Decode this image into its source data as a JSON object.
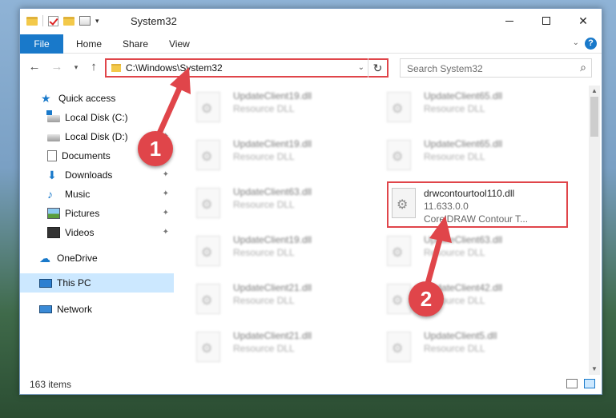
{
  "window": {
    "title": "System32"
  },
  "ribbon": {
    "tabs": [
      {
        "label": "File"
      },
      {
        "label": "Home"
      },
      {
        "label": "Share"
      },
      {
        "label": "View"
      }
    ]
  },
  "navigation": {
    "address_path": "C:\\Windows\\System32",
    "search_placeholder": "Search System32"
  },
  "sidebar": {
    "items": [
      {
        "label": "Quick access",
        "icon": "star-icon"
      },
      {
        "label": "Local Disk (C:)",
        "icon": "drive-icon"
      },
      {
        "label": "Local Disk (D:)",
        "icon": "drive-icon",
        "pinned": true
      },
      {
        "label": "Documents",
        "icon": "documents-icon",
        "pinned": true
      },
      {
        "label": "Downloads",
        "icon": "downloads-icon",
        "pinned": true
      },
      {
        "label": "Music",
        "icon": "music-icon",
        "pinned": true
      },
      {
        "label": "Pictures",
        "icon": "pictures-icon",
        "pinned": true
      },
      {
        "label": "Videos",
        "icon": "videos-icon",
        "pinned": true
      },
      {
        "label": "OneDrive",
        "icon": "cloud-icon"
      },
      {
        "label": "This PC",
        "icon": "computer-icon",
        "selected": true
      },
      {
        "label": "Network",
        "icon": "network-icon"
      }
    ]
  },
  "files": [
    {
      "name": "UpdateClient19.dll",
      "desc": "Resource DLL"
    },
    {
      "name": "UpdateClient65.dll",
      "desc": "Resource DLL"
    },
    {
      "name": "UpdateClient19.dll",
      "desc": "Resource DLL"
    },
    {
      "name": "UpdateClient65.dll",
      "desc": "Resource DLL"
    },
    {
      "name": "UpdateClient63.dll",
      "desc": "Resource DLL"
    },
    {
      "name": "drwcontourtool110.dll",
      "version": "11.633.0.0",
      "desc": "CorelDRAW Contour T..."
    },
    {
      "name": "UpdateClient19.dll",
      "desc": "Resource DLL"
    },
    {
      "name": "UpdateClient63.dll",
      "desc": "Resource DLL"
    },
    {
      "name": "UpdateClient21.dll",
      "desc": "Resource DLL"
    },
    {
      "name": "UpdateClient42.dll",
      "desc": "Resource DLL"
    },
    {
      "name": "UpdateClient21.dll",
      "desc": "Resource DLL"
    },
    {
      "name": "UpdateClient5.dll",
      "desc": "Resource DLL"
    }
  ],
  "status": {
    "item_count": "163 items"
  },
  "callouts": {
    "one": "1",
    "two": "2"
  },
  "colors": {
    "accent": "#1979ca",
    "highlight": "#e0454a",
    "selected_bg": "#cce8ff"
  }
}
